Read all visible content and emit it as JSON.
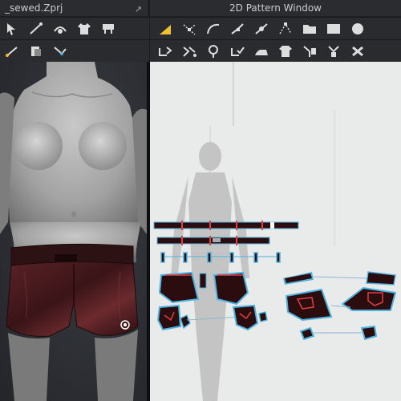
{
  "windows": {
    "left_title": "_sewed.Zprj",
    "right_title": "2D Pattern Window"
  },
  "toolbar_left_top": {
    "icons": [
      "select-icon",
      "brush-icon",
      "stitch-icon",
      "tshirt-icon",
      "pin-icon"
    ]
  },
  "toolbar_left_bottom": {
    "icons": [
      "measure-icon",
      "fold-icon",
      "move-icon"
    ]
  },
  "toolbar_right_top": {
    "icons": [
      "transform-icon",
      "edit-point-icon",
      "curve-icon",
      "curve-point-icon",
      "add-point-icon",
      "polygon-icon",
      "folder-icon",
      "rectangle-icon",
      "circle-icon"
    ]
  },
  "toolbar_right_bottom": {
    "icons": [
      "segment-sew-icon",
      "free-sew-icon",
      "tack-icon",
      "stitch-check-icon",
      "iron-icon",
      "button-icon",
      "buttonhole-icon",
      "topstitch-icon",
      "cross-icon"
    ]
  },
  "colors": {
    "fabric": "#3a1417",
    "fabric_highlight": "#6b2a2e",
    "pattern_outline": "#4fb3e0",
    "sew_line": "#e04040",
    "pattern_bg": "#e9eaea",
    "accent_yellow": "#f2c12e"
  }
}
